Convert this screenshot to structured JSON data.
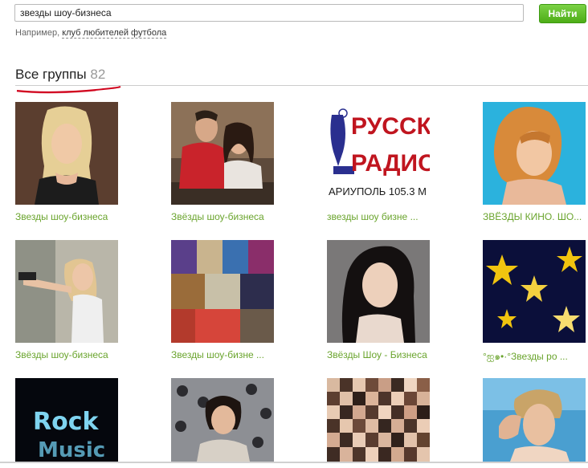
{
  "search": {
    "value": "звезды шоу-бизнеса",
    "button_label": "Найти",
    "hint_prefix": "Например,",
    "hint_link": "клуб любителей футбола"
  },
  "section": {
    "title": "Все группы",
    "count": "82"
  },
  "colors": {
    "accent_green": "#6aa42d",
    "button_green": "#5cb91f",
    "underline_red": "#d0021b"
  },
  "radio_logo": {
    "line1": "РУССКО",
    "line2": "РАДИО",
    "line3": "АРИУПОЛЬ 105.3 М"
  },
  "rock_logo": {
    "line1": "Rock",
    "line2": "Music"
  },
  "groups": [
    {
      "label": "Звезды шоу-бизнеса"
    },
    {
      "label": "Звёзды шоу-бизнеса"
    },
    {
      "label": "звезды шоу бизне ..."
    },
    {
      "label": "ЗВЁЗДЫ КИНО. ШО..."
    },
    {
      "label": "Звёзды шоу-бизнеса"
    },
    {
      "label": "Звезды шоу-бизне ..."
    },
    {
      "label": "Звёзды Шоу - Бизнеса"
    },
    {
      "label": "°ஐ๑•·°Звезды ро ..."
    },
    {
      "label": ""
    },
    {
      "label": ""
    },
    {
      "label": ""
    },
    {
      "label": ""
    }
  ]
}
